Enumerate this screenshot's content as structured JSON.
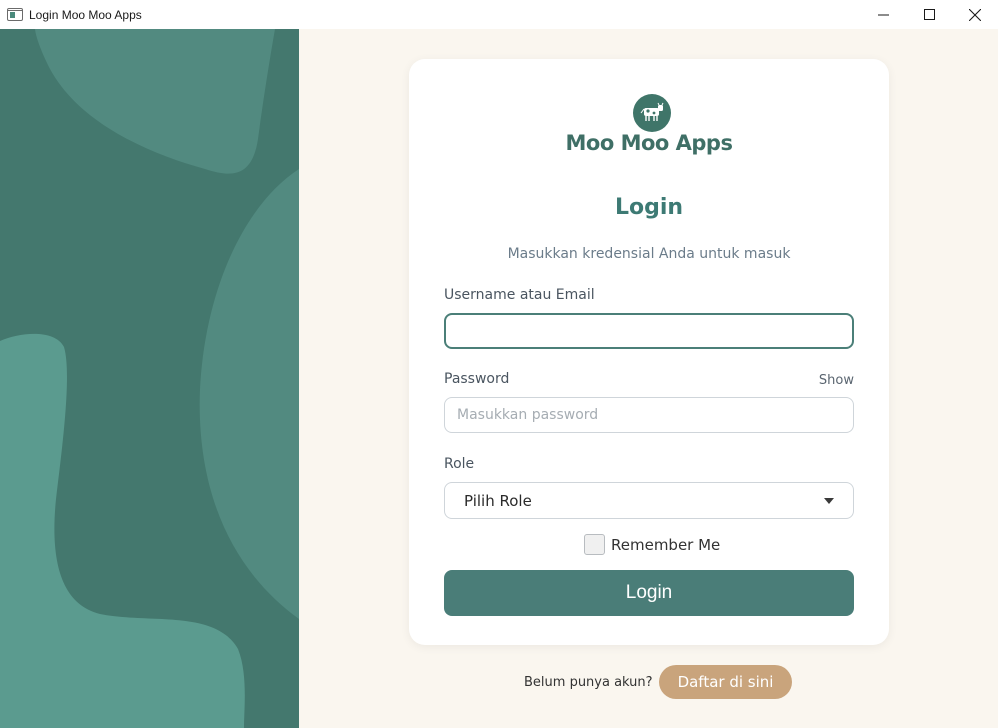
{
  "window": {
    "title": "Login Moo Moo Apps",
    "controls": [
      "minimize",
      "maximize",
      "close"
    ]
  },
  "brand": {
    "name": "Moo Moo Apps",
    "logo_icon": "cow-icon",
    "color": "#3f6f66"
  },
  "login_form": {
    "heading": "Login",
    "subtitle": "Masukkan kredensial Anda untuk masuk",
    "username_label": "Username atau Email",
    "username_value": "",
    "username_placeholder": "",
    "password_label": "Password",
    "password_toggle": "Show",
    "password_value": "",
    "password_placeholder": "Masukkan password",
    "role_label": "Role",
    "role_selected": "Pilih Role",
    "remember_label": "Remember Me",
    "remember_checked": false,
    "submit_label": "Login"
  },
  "footer": {
    "question": "Belum punya akun?",
    "register_label": "Daftar di sini"
  },
  "colors": {
    "accent": "#4a7d78",
    "panel_dark": "#44786e",
    "panel_light": "#5a9a8e",
    "register": "#c9a47c",
    "background": "#faf6ef"
  }
}
